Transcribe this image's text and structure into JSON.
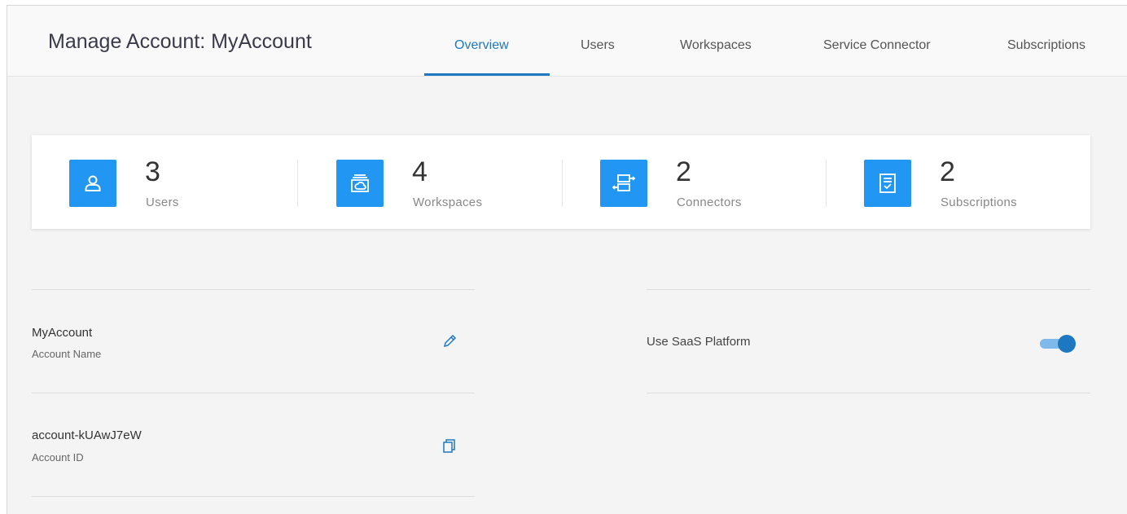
{
  "header": {
    "title": "Manage Account: MyAccount",
    "tabs": [
      {
        "label": "Overview",
        "active": true
      },
      {
        "label": "Users",
        "active": false
      },
      {
        "label": "Workspaces",
        "active": false
      },
      {
        "label": "Service Connector",
        "active": false
      },
      {
        "label": "Subscriptions",
        "active": false
      }
    ]
  },
  "stats": [
    {
      "value": "3",
      "label": "Users",
      "icon": "user-icon"
    },
    {
      "value": "4",
      "label": "Workspaces",
      "icon": "workspace-cloud-icon"
    },
    {
      "value": "2",
      "label": "Connectors",
      "icon": "connector-icon"
    },
    {
      "value": "2",
      "label": "Subscriptions",
      "icon": "subscription-icon"
    }
  ],
  "account": {
    "name_value": "MyAccount",
    "name_label": "Account Name",
    "id_value": "account-kUAwJ7eW",
    "id_label": "Account ID"
  },
  "settings": {
    "saas_label": "Use SaaS Platform",
    "saas_enabled": true
  },
  "colors": {
    "accent": "#1d78c1",
    "icon_tile": "#2196f3",
    "background": "#f4f4f4"
  }
}
